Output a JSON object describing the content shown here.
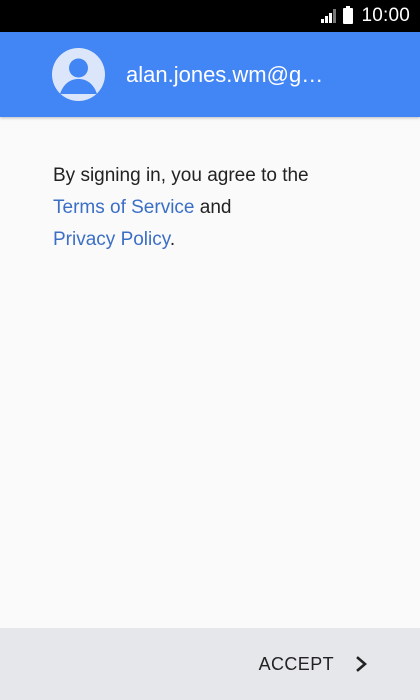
{
  "status_bar": {
    "time": "10:00",
    "signal_icon": "signal-bars",
    "battery_icon": "battery-full"
  },
  "header": {
    "avatar_icon": "default-avatar",
    "email": "alan.jones.wm@g…",
    "color": "#4285f4"
  },
  "consent": {
    "text_prefix": "By signing in, you agree to the",
    "terms_link": "Terms of Service",
    "connector": "and",
    "privacy_link": "Privacy Policy",
    "end": ".",
    "link_color": "#3b6fc6"
  },
  "footer": {
    "accept_label": "ACCEPT",
    "accept_icon": "chevron-right"
  }
}
